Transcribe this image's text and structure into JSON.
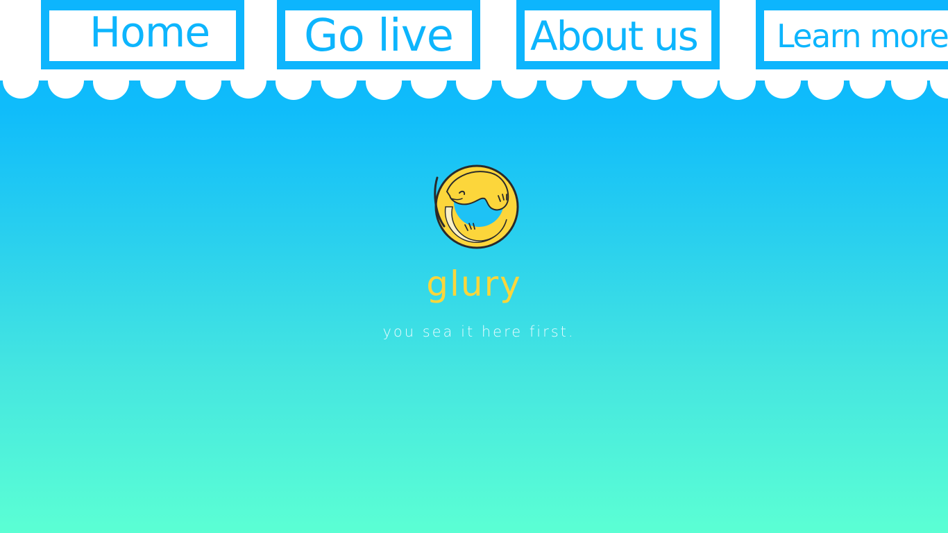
{
  "nav": {
    "items": [
      {
        "label": "Home"
      },
      {
        "label": "Go live"
      },
      {
        "label": "About us"
      },
      {
        "label": "Learn more"
      }
    ]
  },
  "brand": {
    "name": "glury",
    "tagline": "you sea it here first.",
    "logo_icon": "coiled-lizard-icon"
  },
  "colors": {
    "accent": "#0db5fd",
    "brand_yellow": "#fcd63b",
    "gradient_top": "#0db5fd",
    "gradient_bottom": "#5bffd4",
    "white": "#ffffff"
  }
}
